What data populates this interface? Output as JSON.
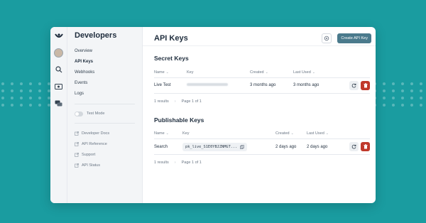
{
  "colors": {
    "background": "#1a9ca0",
    "primary": "#4a7a8c",
    "danger": "#c0392b"
  },
  "rail": {
    "icons": [
      "logo-icon",
      "avatar",
      "search-icon",
      "billing-icon",
      "chat-icon"
    ]
  },
  "sidebar": {
    "title": "Developers",
    "items": [
      {
        "label": "Overview"
      },
      {
        "label": "API Keys"
      },
      {
        "label": "Webhooks"
      },
      {
        "label": "Events"
      },
      {
        "label": "Logs"
      }
    ],
    "test_mode_label": "Test Mode",
    "links": [
      {
        "label": "Developer Docs"
      },
      {
        "label": "API Reference"
      },
      {
        "label": "Support"
      },
      {
        "label": "API Status"
      }
    ]
  },
  "header": {
    "title": "API Keys",
    "create_button": "Create API Key"
  },
  "secret": {
    "title": "Secret Keys",
    "columns": {
      "name": "Name",
      "key": "Key",
      "created": "Created",
      "last_used": "Last Used"
    },
    "rows": [
      {
        "name": "Live Test",
        "created": "3 months ago",
        "last_used": "3 months ago"
      }
    ],
    "pager": {
      "results": "1 results",
      "page": "Page 1 of 1"
    }
  },
  "publishable": {
    "title": "Publishable Keys",
    "columns": {
      "name": "Name",
      "key": "Key",
      "created": "Created",
      "last_used": "Last Used"
    },
    "rows": [
      {
        "name": "Search",
        "key": "pk_live_S1E0YBJZNMGT...",
        "created": "2 days ago",
        "last_used": "2 days ago"
      }
    ],
    "pager": {
      "results": "1 results",
      "page": "Page 1 of 1"
    }
  }
}
